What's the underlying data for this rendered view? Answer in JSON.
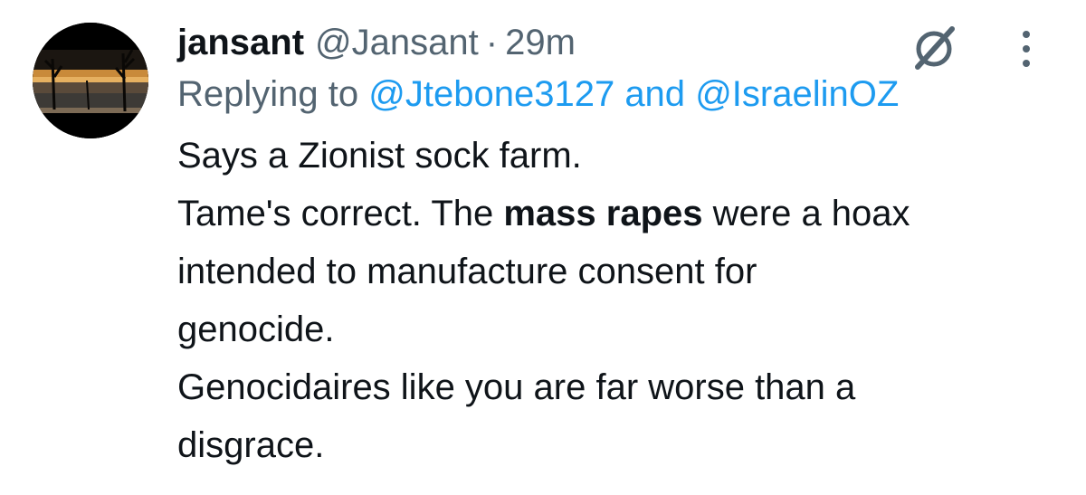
{
  "tweet": {
    "display_name": "jansant",
    "handle": "@Jansant",
    "separator": "·",
    "time": "29m",
    "reply": {
      "prefix": "Replying to",
      "mention_1": "@Jtebone3127",
      "joiner": "and",
      "mention_2": "@IsraelinOZ"
    },
    "body": {
      "line_1": "Says a Zionist sock farm.",
      "line_2_pre": "Tame's correct. The ",
      "line_2_bold": "mass rapes",
      "line_2_post": " were a hoax",
      "line_3": "intended to manufacture consent for",
      "line_4": "genocide.",
      "line_5": "Genocidaires like you are far worse than a",
      "line_6": "disgrace."
    },
    "icons": {
      "avatar": "avatar-image",
      "grok": "grok-icon",
      "more": "more-icon"
    },
    "colors": {
      "text": "#0f1419",
      "secondary": "#536471",
      "mention": "#1d9bf0"
    }
  }
}
